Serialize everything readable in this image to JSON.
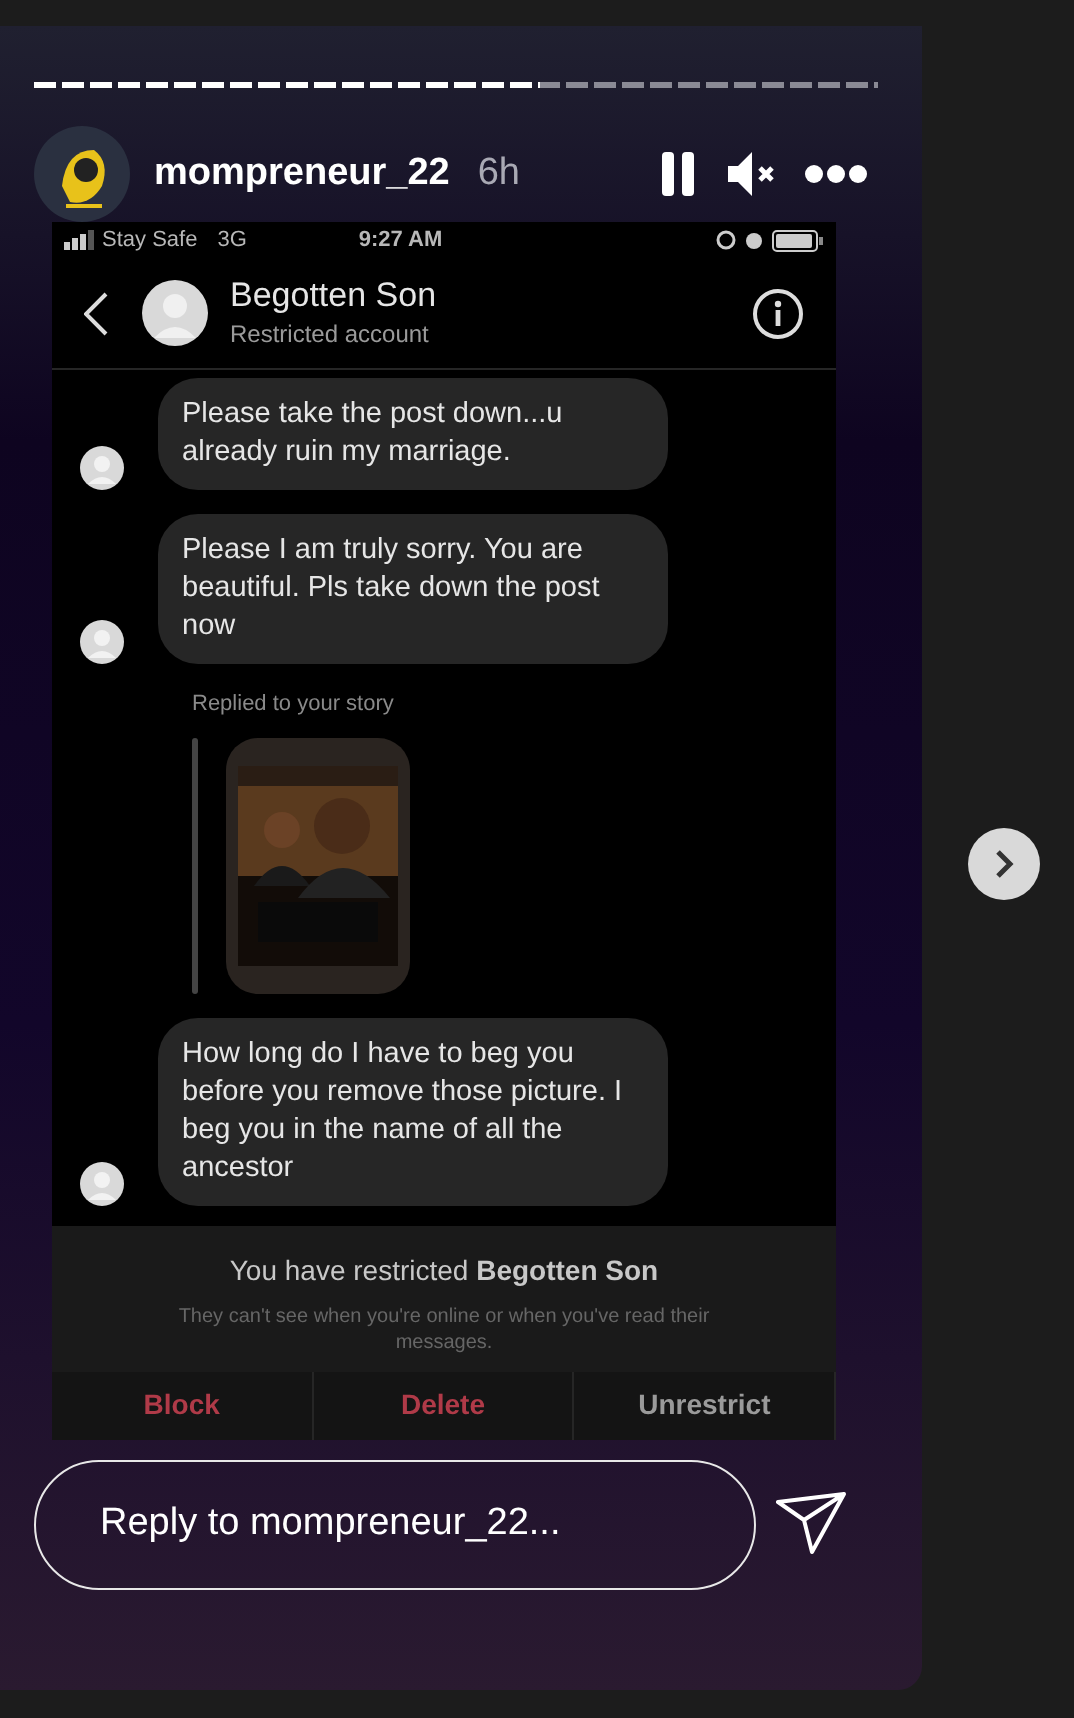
{
  "story": {
    "progress": {
      "level": 0.6
    },
    "user": {
      "name": "mompreneur_22",
      "time": "6h"
    },
    "paused": true,
    "muted": true
  },
  "screenshot": {
    "status_bar": {
      "carrier": "Stay Safe",
      "network": "3G",
      "time": "9:27 AM"
    },
    "header": {
      "name": "Begotten Son",
      "subtitle": "Restricted account"
    },
    "messages": [
      {
        "kind": "text",
        "text": "Please take the post down...u already ruin my marriage."
      },
      {
        "kind": "text",
        "text": "Please I am truly sorry. You are beautiful. Pls take down the post now"
      },
      {
        "kind": "story_reply",
        "label": "Replied to your story"
      },
      {
        "kind": "text",
        "text": "How long do I have to beg you before you remove those picture. I beg you in the name of all the ancestor"
      }
    ],
    "notice": {
      "title": "You have restricted **Begotten Son**",
      "subtitle": "They can't see when you're online or when you've read their messages."
    },
    "actions": [
      {
        "label": "Block",
        "kind": "danger"
      },
      {
        "label": "Delete",
        "kind": "danger"
      },
      {
        "label": "Unrestrict",
        "kind": "normal"
      }
    ]
  },
  "reply": {
    "placeholder": "Reply to mompreneur_22..."
  }
}
